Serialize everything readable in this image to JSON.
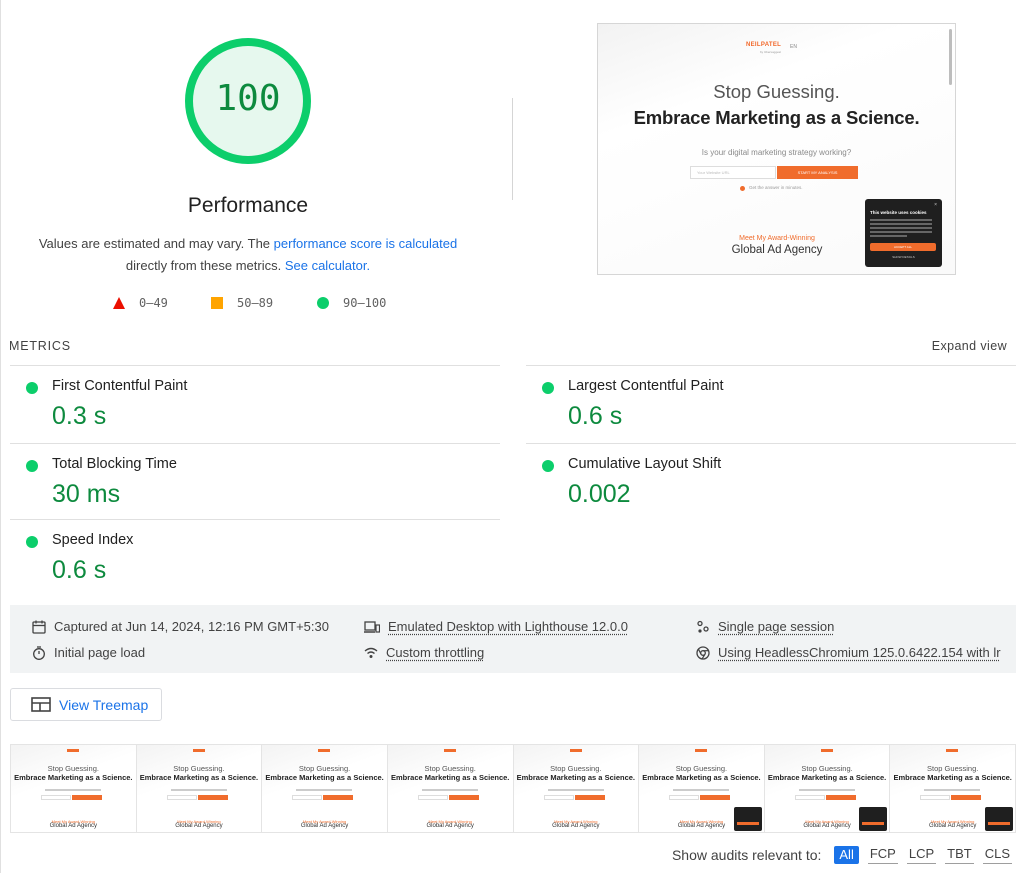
{
  "performance": {
    "score": "100",
    "title": "Performance",
    "desc_prefix": "Values are estimated and may vary. The ",
    "desc_link1": "performance score is calculated",
    "desc_middle": "directly from these metrics. ",
    "desc_link2": "See calculator.",
    "score_color": "#0cce6b",
    "score_text_color": "#0d8a3e"
  },
  "legend": [
    {
      "label": "0–49",
      "color": "#eb0f00",
      "icon": "triangle-icon"
    },
    {
      "label": "50–89",
      "color": "#ffa400",
      "icon": "square-icon"
    },
    {
      "label": "90–100",
      "color": "#0cce6b",
      "icon": "circle-icon"
    }
  ],
  "screenshot": {
    "logo": "NEILPATEL",
    "logo_sub": "by Ubersuggest",
    "lang": "EN",
    "headline1": "Stop Guessing.",
    "headline2": "Embrace Marketing as a Science.",
    "question": "Is your digital marketing strategy working?",
    "input_placeholder": "Your Website URL",
    "button": "START MY ANALYSIS",
    "small": "Get the answer in minutes.",
    "award": "Meet My Award-Winning",
    "agency": "Global Ad Agency",
    "cookie_title": "This website uses cookies",
    "cookie_accept": "ACCEPT ALL",
    "cookie_settings": "SHOW DETAILS"
  },
  "metrics": {
    "header": "METRICS",
    "expand": "Expand view",
    "items": [
      {
        "label": "First Contentful Paint",
        "value": "0.3 s"
      },
      {
        "label": "Largest Contentful Paint",
        "value": "0.6 s"
      },
      {
        "label": "Total Blocking Time",
        "value": "30 ms"
      },
      {
        "label": "Cumulative Layout Shift",
        "value": "0.002"
      },
      {
        "label": "Speed Index",
        "value": "0.6 s"
      }
    ]
  },
  "info": {
    "captured": "Captured at Jun 14, 2024, 12:16 PM GMT+5:30",
    "load": "Initial page load",
    "emulated": "Emulated Desktop with Lighthouse 12.0.0",
    "throttling": "Custom throttling",
    "session": "Single page session",
    "browser": "Using HeadlessChromium 125.0.6422.154 with lr"
  },
  "treemap": {
    "label": "View Treemap"
  },
  "filmstrip": {
    "frame_headline1": "Stop Guessing.",
    "frame_headline2": "Embrace Marketing as a Science.",
    "frame_award": "Meet My Award-Winning",
    "frame_agency": "Global Ad Agency"
  },
  "audits": {
    "label": "Show audits relevant to:",
    "filters": [
      "All",
      "FCP",
      "LCP",
      "TBT",
      "CLS"
    ],
    "active": "All"
  }
}
